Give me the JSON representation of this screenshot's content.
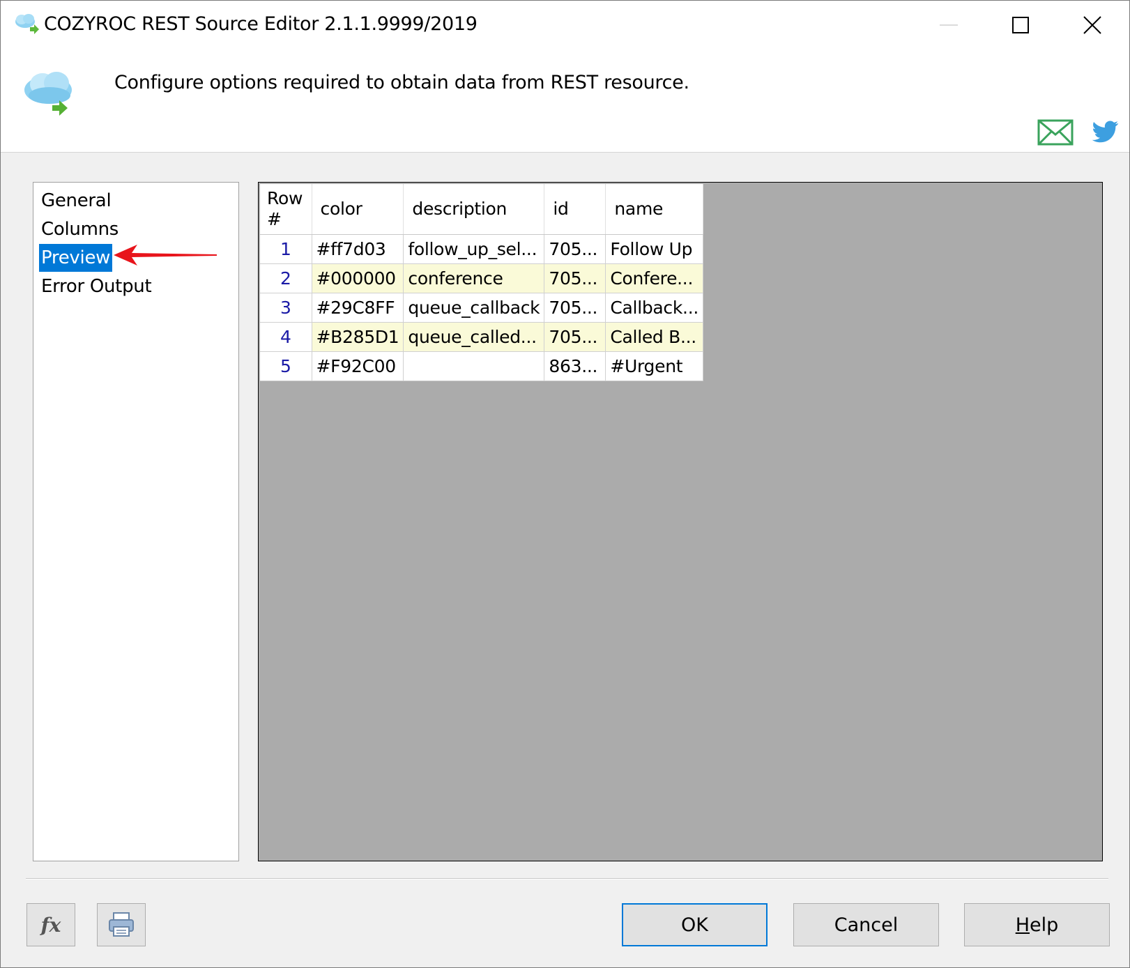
{
  "window": {
    "title": "COZYROC REST Source Editor 2.1.1.9999/2019",
    "minimize_glyph": "—",
    "maximize_glyph": "☐",
    "close_glyph": "✕"
  },
  "header": {
    "description": "Configure options required to obtain data from REST resource.",
    "icons": [
      "cloud-arrow-icon",
      "mail-icon",
      "twitter-icon"
    ]
  },
  "nav": {
    "items": [
      {
        "label": "General",
        "selected": false
      },
      {
        "label": "Columns",
        "selected": false
      },
      {
        "label": "Preview",
        "selected": true
      },
      {
        "label": "Error Output",
        "selected": false
      }
    ],
    "annotation": "red-arrow-icon"
  },
  "preview": {
    "columns": [
      "Row #",
      "color",
      "description",
      "id",
      "name"
    ],
    "row_header_line1": "Row",
    "row_header_line2": "#",
    "rows": [
      {
        "num": "1",
        "color": "#ff7d03",
        "description": "follow_up_sel...",
        "id": "705...",
        "name": "Follow Up"
      },
      {
        "num": "2",
        "color": "#000000",
        "description": "conference",
        "id": "705...",
        "name": "Confere..."
      },
      {
        "num": "3",
        "color": "#29C8FF",
        "description": "queue_callback",
        "id": "705...",
        "name": "Callback..."
      },
      {
        "num": "4",
        "color": "#B285D1",
        "description": "queue_called...",
        "id": "705...",
        "name": "Called B..."
      },
      {
        "num": "5",
        "color": "#F92C00",
        "description": "",
        "id": "863...",
        "name": "#Urgent"
      }
    ]
  },
  "footer": {
    "fx_label": "fx",
    "ok_label": "OK",
    "cancel_label": "Cancel",
    "help_label_prefix": "H",
    "help_label_rest": "elp"
  },
  "colors": {
    "selection": "#0078d7",
    "grid_background": "#ababab",
    "alt_row": "#fafad8",
    "row_number": "#1a1aa6",
    "arrow": "#e8141b"
  }
}
